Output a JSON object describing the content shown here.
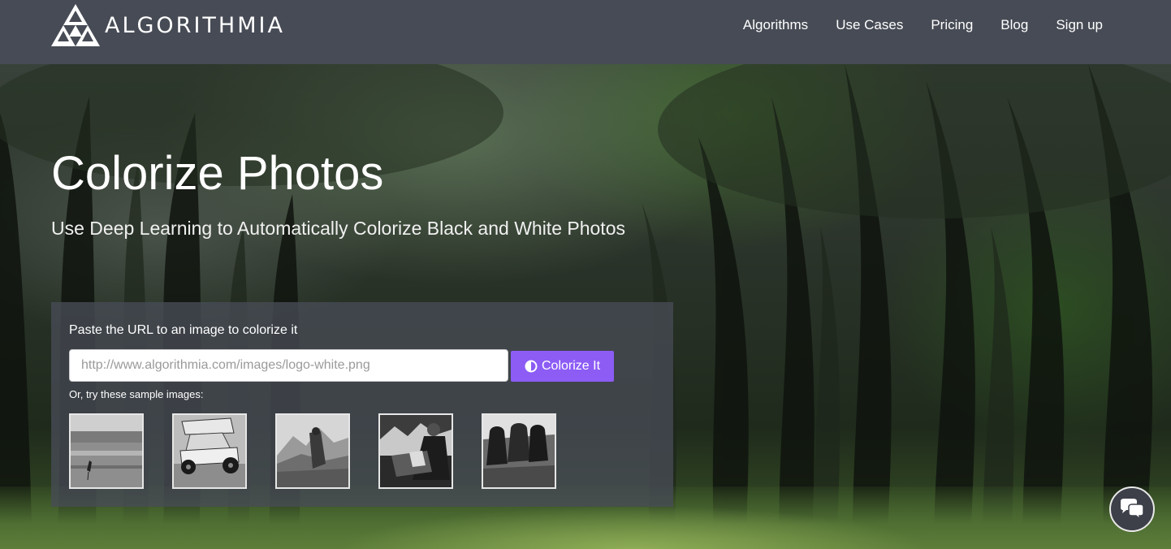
{
  "brand": {
    "name": "ALGORITHMIA",
    "logo_icon": "algorithmia-triangle-logo"
  },
  "nav": {
    "items": [
      {
        "label": "Algorithms"
      },
      {
        "label": "Use Cases"
      },
      {
        "label": "Pricing"
      },
      {
        "label": "Blog"
      },
      {
        "label": "Sign up"
      }
    ]
  },
  "hero": {
    "title": "Colorize Photos",
    "subtitle": "Use Deep Learning to Automatically Colorize Black and White Photos"
  },
  "colorize_panel": {
    "label": "Paste the URL to an image to colorize it",
    "url_input": {
      "value": "",
      "placeholder": "http://www.algorithmia.com/images/logo-white.png"
    },
    "button_label": "Colorize It",
    "button_icon": "contrast-icon",
    "button_color": "#8c5cf5",
    "samples_label": "Or, try these sample images:",
    "samples": [
      {
        "subject": "heron-in-water"
      },
      {
        "subject": "sprint-race-car"
      },
      {
        "subject": "mountain-hiker"
      },
      {
        "subject": "portrait-with-mountains"
      },
      {
        "subject": "cattle"
      }
    ]
  },
  "chat_widget": {
    "icon": "chat-bubbles-icon"
  },
  "colors": {
    "navbar_bg": "#474b55",
    "panel_bg": "rgba(72,76,86,0.78)",
    "accent": "#8c5cf5"
  }
}
